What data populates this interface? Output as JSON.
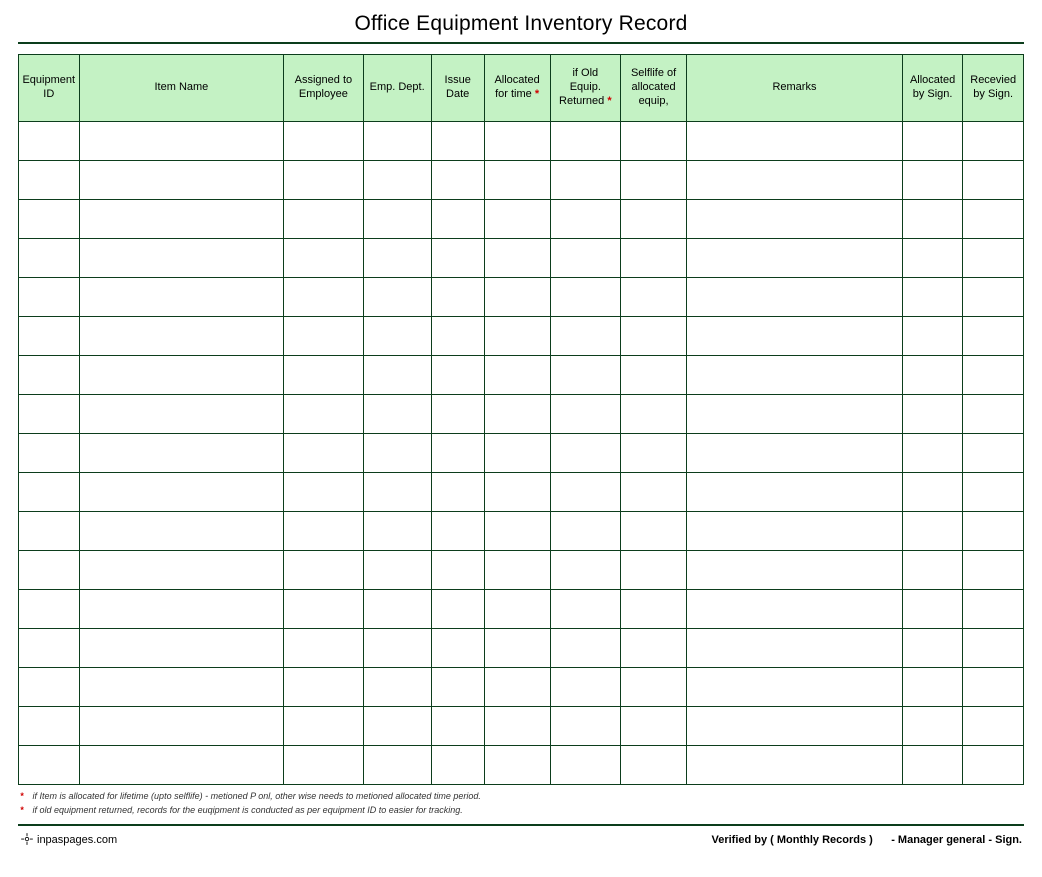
{
  "title": "Office Equipment Inventory Record",
  "columns": [
    {
      "label": "Equipment\nID",
      "asterisk": false
    },
    {
      "label": "Item Name",
      "asterisk": false
    },
    {
      "label": "Assigned to\nEmployee",
      "asterisk": false
    },
    {
      "label": "Emp. Dept.",
      "asterisk": false
    },
    {
      "label": "Issue\nDate",
      "asterisk": false
    },
    {
      "label": "Allocated\nfor time",
      "asterisk": true
    },
    {
      "label": "if Old\nEquip.\nReturned",
      "asterisk": true
    },
    {
      "label": "Selflife of\nallocated\nequip,",
      "asterisk": false
    },
    {
      "label": "Remarks",
      "asterisk": false
    },
    {
      "label": "Allocated\nby Sign.",
      "asterisk": false
    },
    {
      "label": "Recevied\nby Sign.",
      "asterisk": false
    }
  ],
  "row_count": 17,
  "notes": [
    "if Item is allocated for lifetime (upto selflife) - metioned P onl, other wise needs to metioned allocated time period.",
    "if old equipment returned, records for the euqipment is conducted as per equipment ID to easier for tracking."
  ],
  "footer": {
    "source": "inpaspages.com",
    "verify_label": "Verified by ( Monthly Records )",
    "signer": "- Manager general - Sign."
  },
  "colors": {
    "header_bg": "#c4f2c4",
    "border": "#0c3d1c",
    "asterisk": "#d00000"
  }
}
